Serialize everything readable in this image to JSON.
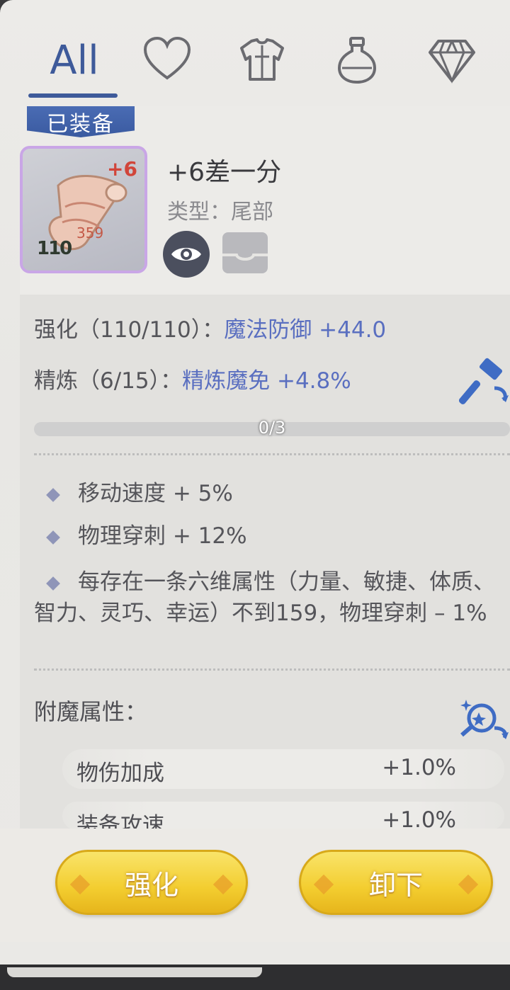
{
  "tabs": {
    "all_label": "All",
    "items": [
      {
        "icon": "heart-icon"
      },
      {
        "icon": "armor-icon"
      },
      {
        "icon": "potion-icon"
      },
      {
        "icon": "diamond-icon"
      }
    ]
  },
  "item": {
    "badge": "已装备",
    "name": "+6差一分",
    "type_label": "类型：尾部",
    "plus": "+6",
    "level": "110"
  },
  "stats": {
    "strengthen_label": "强化（110/110）：",
    "strengthen_value": "魔法防御 +44.0",
    "refine_label": "精炼（6/15）：",
    "refine_value": "精炼魔免 +4.8%",
    "progress_text": "0/3",
    "progress_fraction": 0
  },
  "effects": [
    "移动速度 + 5%",
    "物理穿刺 + 12%",
    "每存在一条六维属性（力量、敏捷、体质、智力、灵巧、幸运）不到159，物理穿刺 – 1%"
  ],
  "enchant": {
    "title": "附魔属性：",
    "rows": [
      {
        "name": "物伤加成",
        "value": "+1.0%"
      },
      {
        "name": "装备攻速",
        "value": "+1.0%"
      }
    ]
  },
  "buttons": {
    "strengthen": "强化",
    "unequip": "卸下"
  },
  "colors": {
    "accent": "#3e5a9a",
    "value_text": "#5a6fc0",
    "button_gold": "#f3cd2f"
  }
}
